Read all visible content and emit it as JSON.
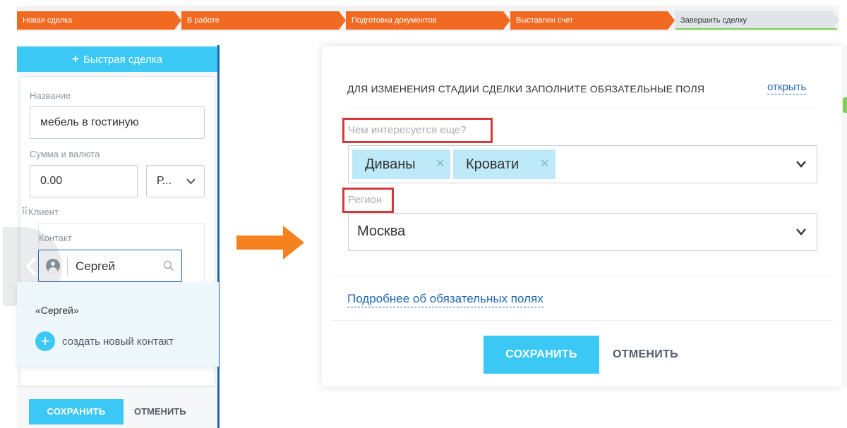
{
  "pipeline": {
    "stages": [
      {
        "label": "Новая сделка",
        "state": "done"
      },
      {
        "label": "В работе",
        "state": "done"
      },
      {
        "label": "Подготовка документов",
        "state": "done"
      },
      {
        "label": "Выставлен счет",
        "state": "done"
      },
      {
        "label": "Завершить сделку",
        "state": "current"
      }
    ],
    "colors": {
      "done": "#f26a22",
      "current": "#e1e4e8",
      "progress": "#7fcf55"
    }
  },
  "quick_deal": {
    "button_label": "Быстрая сделка",
    "name_label": "Название",
    "name_value": "мебель в гостиную",
    "amount_label": "Сумма и валюта",
    "amount_value": "0.00",
    "currency_value": "Р...",
    "client_label": "Клиент",
    "contact_label": "Контакт",
    "contact_value": "Сергей",
    "dropdown": {
      "match_item": "«Сергей»",
      "create_label": "создать новый контакт"
    },
    "save_label": "СОХРАНИТЬ",
    "cancel_label": "ОТМЕНИТЬ"
  },
  "dialog": {
    "title": "ДЛЯ ИЗМЕНЕНИЯ СТАДИИ СДЕЛКИ ЗАПОЛНИТЕ ОБЯЗАТЕЛЬНЫЕ ПОЛЯ",
    "open_link": "открыть",
    "interest_label": "Чем интересуется еще?",
    "interest_tags": [
      "Диваны",
      "Кровати"
    ],
    "region_label": "Регион",
    "region_value": "Москва",
    "more_link": "Подробнее об обязательных полях",
    "save_label": "СОХРАНИТЬ",
    "cancel_label": "ОТМЕНИТЬ"
  },
  "colors": {
    "accent": "#3bc8f5",
    "link": "#2067b0",
    "highlight": "#d53a3a",
    "arrow": "#f5821f"
  }
}
